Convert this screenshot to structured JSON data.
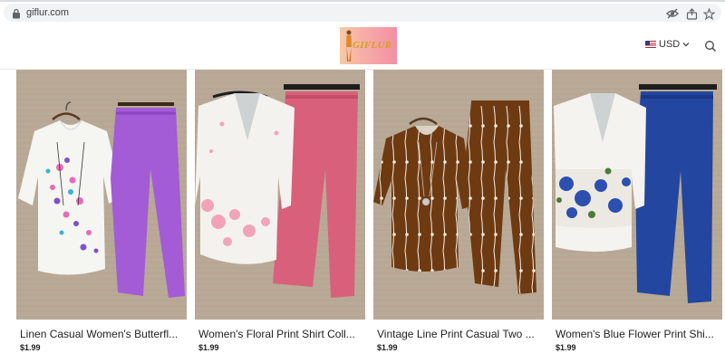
{
  "browser": {
    "url": "giflur.com",
    "icons": [
      "eye-off-icon",
      "share-icon",
      "star-icon"
    ]
  },
  "store": {
    "logo_text": "GIFLUR",
    "currency": "USD",
    "icons": [
      "flag-us-icon",
      "chevron-down-icon",
      "search-icon"
    ]
  },
  "products": [
    {
      "title": "Linen Casual Women's Butterfly Print Shirt Two Piece Set",
      "display_title": "Linen Casual Women's Butterfl...",
      "price": "$1.99"
    },
    {
      "title": "Women's Floral Print Shirt Collar Two Piece Set",
      "display_title": "Women's Floral Print Shirt Coll...",
      "price": "$1.99"
    },
    {
      "title": "Vintage Line Print Casual Two Piece Set",
      "display_title": "Vintage Line Print Casual Two ...",
      "price": "$1.99"
    },
    {
      "title": "Women's Blue Flower Print Shirt Two Piece Set",
      "display_title": "Women's Blue Flower Print Shi...",
      "price": "$1.99"
    }
  ],
  "colors": {
    "backdrop": "#b8a895",
    "lilac_pants": "#a35bd6",
    "pink_pants": "#d9607a",
    "brown_set": "#6e3a12",
    "blue_pants": "#2346a0"
  }
}
